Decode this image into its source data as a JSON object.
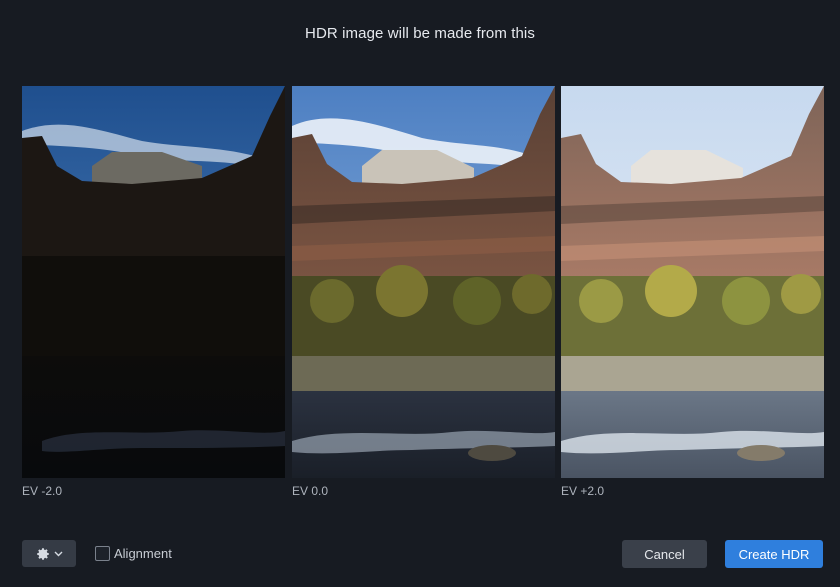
{
  "dialog": {
    "title": "HDR image will be made from this"
  },
  "exposures": [
    {
      "label": "EV -2.0"
    },
    {
      "label": "EV 0.0"
    },
    {
      "label": "EV +2.0"
    }
  ],
  "footer": {
    "settings_icon": "gear-icon",
    "dropdown_icon": "chevron-down-icon",
    "alignment_label": "Alignment",
    "alignment_checked": false,
    "cancel_label": "Cancel",
    "create_label": "Create HDR"
  },
  "colors": {
    "background": "#171b22",
    "accent": "#2f7fdd"
  }
}
